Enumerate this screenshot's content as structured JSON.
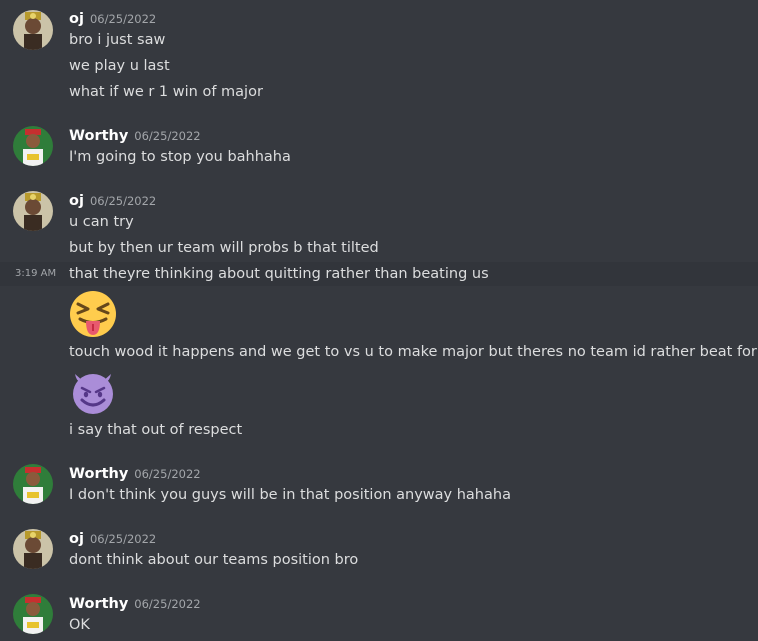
{
  "messages": [
    {
      "author": "oj",
      "timestamp": "06/25/2022",
      "avatar": "oj-avatar",
      "lines": [
        "bro i just saw",
        "we play u last",
        "what if we r 1 win of major"
      ]
    },
    {
      "author": "Worthy",
      "timestamp": "06/25/2022",
      "avatar": "worthy-avatar",
      "lines": [
        "I'm going to stop you bahhaha"
      ]
    },
    {
      "author": "oj",
      "timestamp": "06/25/2022",
      "avatar": "oj-avatar",
      "lines": [
        "u can try",
        "but by then ur team will probs b that tilted",
        "that theyre thinking about quitting rather than beating us",
        "touch wood it happens and we get to vs u to make major but theres no team id rather beat for it",
        "i say that out of respect"
      ],
      "hover_time": "3:19 AM",
      "emojis": [
        "squinting-face-with-tongue-emoji",
        "smiling-face-with-horns-emoji"
      ]
    },
    {
      "author": "Worthy",
      "timestamp": "06/25/2022",
      "avatar": "worthy-avatar",
      "lines": [
        "I don't think you guys will be in that position anyway hahaha"
      ]
    },
    {
      "author": "oj",
      "timestamp": "06/25/2022",
      "avatar": "oj-avatar",
      "lines": [
        "dont think about our teams position bro"
      ]
    },
    {
      "author": "Worthy",
      "timestamp": "06/25/2022",
      "avatar": "worthy-avatar",
      "lines": [
        "OK"
      ]
    }
  ],
  "colors": {
    "background": "#36393f",
    "hover_row": "#32353b",
    "username": "#ffffff",
    "text": "#dcddde",
    "timestamp": "#a3a6aa"
  }
}
